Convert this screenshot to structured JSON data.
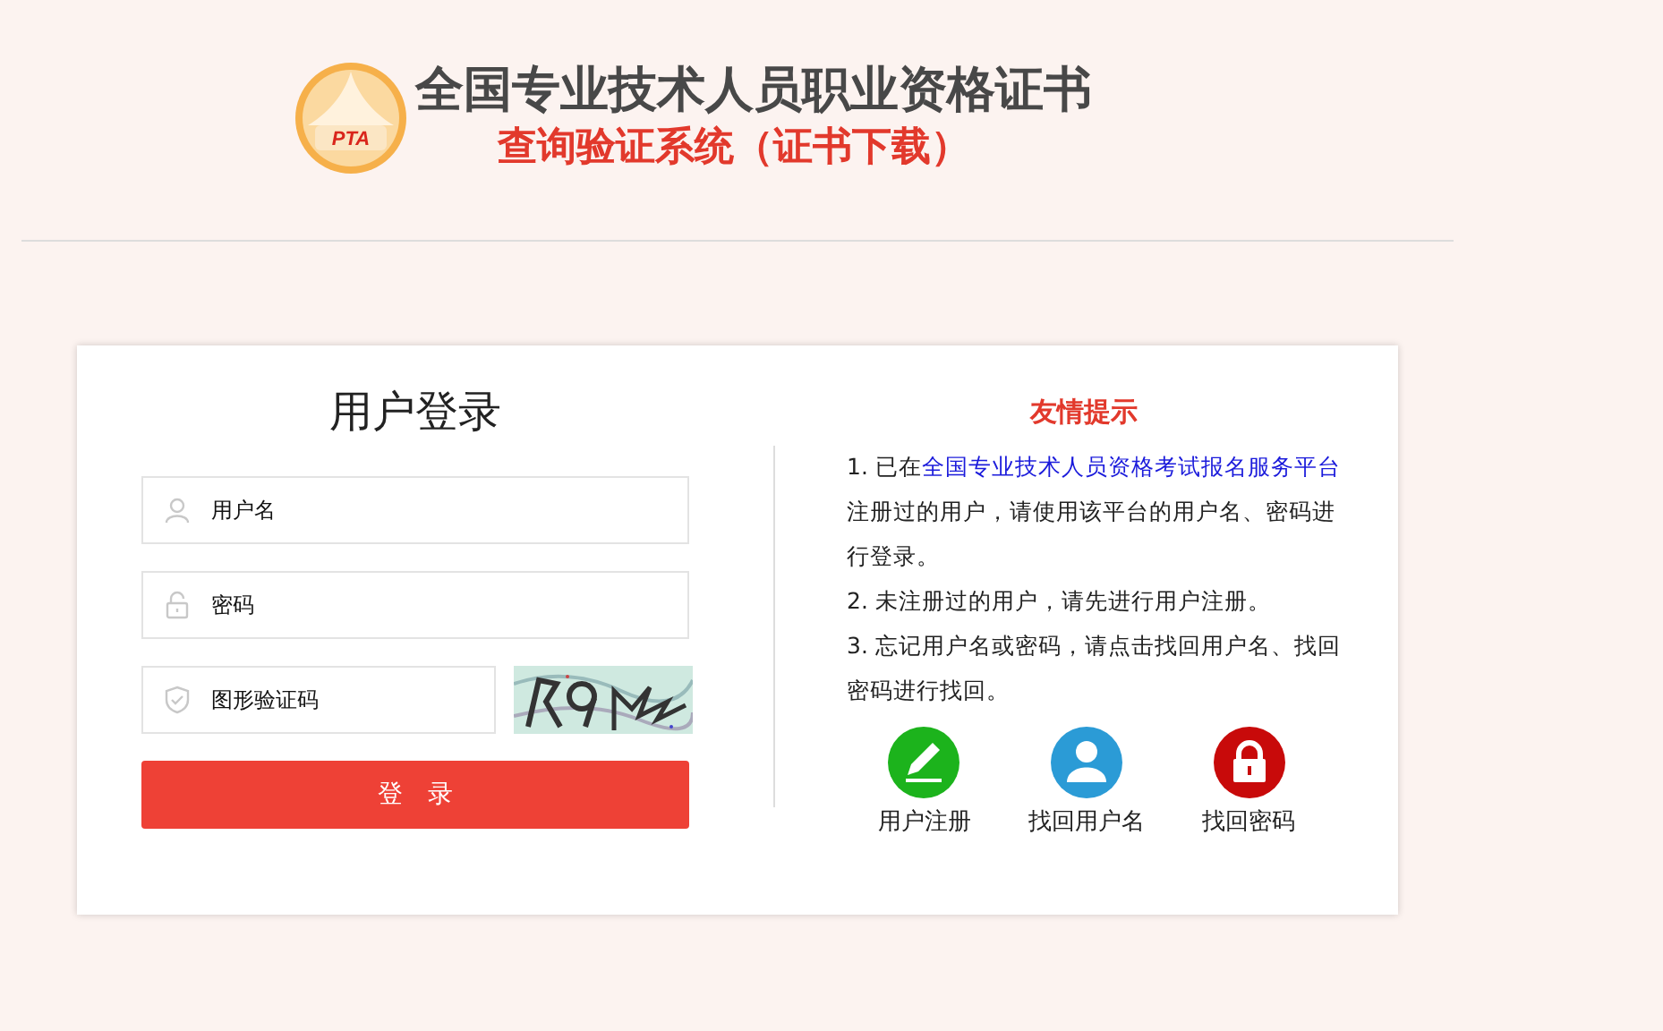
{
  "header": {
    "logo_text": "PTA",
    "title": "全国专业技术人员职业资格证书",
    "subtitle": "查询验证系统（证书下载）"
  },
  "login": {
    "title": "用户登录",
    "fields": [
      {
        "kind": "user",
        "placeholder": "用户名"
      },
      {
        "kind": "lock",
        "placeholder": "密码"
      },
      {
        "kind": "captcha",
        "placeholder": "图形验证码"
      }
    ],
    "submit": "登　录"
  },
  "tips": {
    "title": "友情提示",
    "notes": [
      {
        "text": "1. 已在",
        "link": "全国专业技术人员资格考试报名服务平台",
        "rest": "注册过的用户，请使用该平台的用户名、密码进行登录。"
      },
      {
        "text": "2. 未注册过的用户，请先进行用户注册。"
      },
      {
        "text": "3. 忘记用户名或密码，请点击找回用户名、找回密码进行找回。"
      }
    ],
    "shortcuts": [
      {
        "kind": "pencil",
        "color": "#1cb31c",
        "label": "用户注册"
      },
      {
        "kind": "user",
        "color": "#2b9bd6",
        "label": "找回用户名"
      },
      {
        "kind": "lock",
        "color": "#c80a0a",
        "label": "找回密码"
      }
    ]
  }
}
